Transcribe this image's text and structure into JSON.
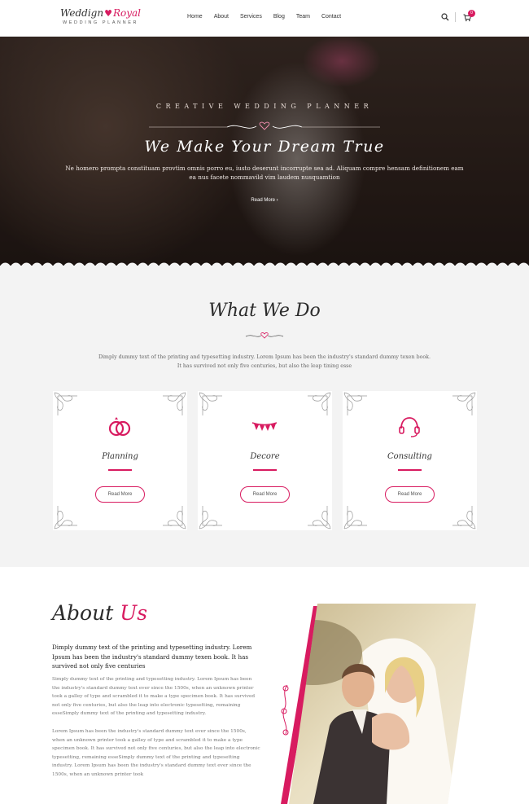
{
  "header": {
    "logo_script_a": "Weddign",
    "logo_script_b": "Royal",
    "logo_sub": "WEDDING PLANNER",
    "nav": [
      "Home",
      "About",
      "Services",
      "Blog",
      "Team",
      "Contact"
    ],
    "cart_count": "0",
    "icons": [
      "search-icon",
      "cart-icon"
    ]
  },
  "hero": {
    "kicker": "CREATIVE WEDDING PLANNER",
    "title": "We Make Your Dream True",
    "text": "Ne homero prompta constituam provtim omnis porro eu, iusto deserunt incorrupte sea ad. Aliquam compre hensam definitionem eam ea nus facete nommavild vim laudem nusquamtion",
    "button": "Read More ›"
  },
  "services": {
    "title": "What We Do",
    "description": "Dimply dummy text of the printing and typesetting industry. Lorem Ipsum has been the industry's standard dummy texen book. It has survived not only five centuries, but also the leap tining esse",
    "cards": [
      {
        "title": "Planning",
        "button": "Read More",
        "icon": "rings-icon"
      },
      {
        "title": "Decore",
        "button": "Read More",
        "icon": "bunting-icon"
      },
      {
        "title": "Consulting",
        "button": "Read More",
        "icon": "headset-icon"
      }
    ]
  },
  "about": {
    "title_a": "About",
    "title_b": "Us",
    "lead": "Dimply dummy text of the printing and typesetting industry. Lorem Ipsum has been the industry's standard dummy texen book. It has survived not only five centuries",
    "p1": "Simply dummy text of the printing and typesetting industry. Lorem Ipsum has been the industry's standard dummy text ever since the 1500s, when an unknown printer took a galley of type and scrambled it to make a type specimen book. It has survived not only five centuries, but also the leap into electronic typesetting, remaining esseSimply dummy text of the printing and typesetting industry.",
    "p2": "Lorem Ipsum has been the industry's standard dummy text ever since the 1500s, when an unknown printer took a galley of type and scrambled it to make a type specimen book. It has survived not only five centuries, but also the leap into electronic typesetting, remaining esseSimply dummy text of the printing and typesetting industry. Lorem Ipsum has been the industry's standard dummy text ever since the 1500s, when an unknown printer took"
  },
  "colors": {
    "accent": "#d81b60",
    "section_bg": "#f3f3f3"
  }
}
